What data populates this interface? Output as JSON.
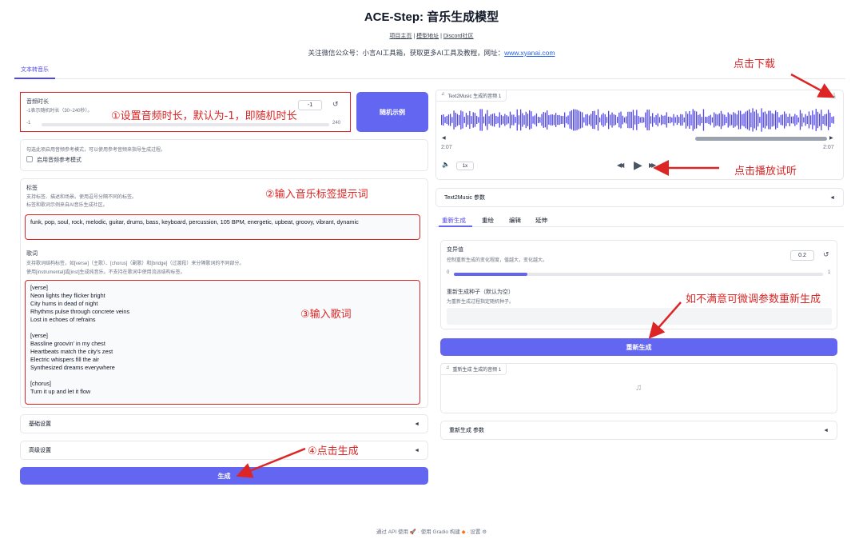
{
  "header": {
    "title": "ACE-Step: 音乐生成模型",
    "link_project": "项目主页",
    "link_model": "模型地址",
    "link_discord": "Discord社区",
    "link_sep": " | ",
    "notice_text": "关注微信公众号：小言AI工具箱，获取更多AI工具及教程，网址：",
    "notice_link": "www.xyanai.com"
  },
  "tabs": {
    "active": "文本转音乐"
  },
  "left": {
    "duration": {
      "label": "音频时长",
      "hint": "-1表示随机时长（30~240秒）。",
      "value": "-1",
      "min": "-1",
      "max": "240",
      "reset_icon": "↺"
    },
    "random_button": "随机示例",
    "ref": {
      "hint": "勾选此项启用音频参考模式，可以使用参考音频来指导生成过程。",
      "checkbox_label": "启用音频参考模式"
    },
    "tags": {
      "label": "标签",
      "hint1": "支持标签、描述和场景。使用逗号分隔不同的标签。",
      "hint2": "标签和歌词示例来自AI音乐生成社区。",
      "value": "funk, pop, soul, rock, melodic, guitar, drums, bass, keyboard, percussion, 105 BPM, energetic, upbeat, groovy, vibrant, dynamic"
    },
    "lyrics": {
      "label": "歌词",
      "hint1": "支持歌词结构标签，如[verse]（主歌）、[chorus]（副歌）和[bridge]（过渡段）来分隔歌词的不同部分。",
      "hint2": "使用[instrumental]或[inst]生成纯音乐。不支持在歌词中使用流派结构标签。",
      "lines": [
        "[verse]",
        "Neon lights they flicker bright",
        "City hums in dead of night",
        "Rhythms pulse through concrete veins",
        "Lost in echoes of refrains",
        "",
        "[verse]",
        "Bassline groovin' in my chest",
        "Heartbeats match the city's zest",
        "Electric whispers fill the air",
        "Synthesized dreams everywhere",
        "",
        "[chorus]",
        "Turn it up and let it flow"
      ]
    },
    "basic_settings": "基础设置",
    "advanced_settings": "高级设置",
    "generate_button": "生成",
    "caret": "◄"
  },
  "right": {
    "audio1": {
      "chip": "Text2Music 生成的音频 1",
      "time_current": "2:07",
      "time_total": "2:07",
      "speed": "1x",
      "download_icon": "⤓",
      "volume_icon": "🔈",
      "rewind_icon": "◀◀",
      "play_icon": "▶",
      "forward_icon": "▶▶",
      "scroll_left": "◀",
      "scroll_right": "▶"
    },
    "params_accordion": "Text2Music 参数",
    "subtabs": [
      "重新生成",
      "重绘",
      "编辑",
      "延伸"
    ],
    "variance": {
      "label": "变异值",
      "hint": "控制重新生成的变化程度，值越大，变化越大。",
      "value": "0.2",
      "min": "0",
      "max": "1",
      "level": 0.2
    },
    "seed": {
      "label": "重新生成种子（默认为空）",
      "hint": "为重新生成过程指定随机种子。"
    },
    "regen_button": "重新生成",
    "audio2": {
      "chip": "重新生成 生成的音频 1",
      "note_icon": "♫"
    },
    "regen_params": "重新生成 参数",
    "caret": "◄"
  },
  "annotations": {
    "a1": "①设置音频时长，默认为-1，即随机时长",
    "a2": "②输入音乐标签提示词",
    "a3": "③输入歌词",
    "a4": "④点击生成",
    "download": "点击下载",
    "play": "点击播放试听",
    "adjust": "如不满意可微调参数重新生成"
  },
  "footer": {
    "api": "通过 API 使用",
    "gradio": "使用 Gradio 构建",
    "settings": "设置",
    "dot": " · "
  },
  "colors": {
    "accent": "#6366f1",
    "annotation": "#dc2626"
  }
}
